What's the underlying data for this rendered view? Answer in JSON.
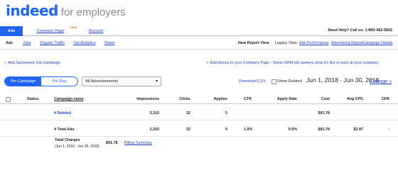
{
  "brand": {
    "logo": "indeed",
    "suffix": "for employers"
  },
  "topnav": {
    "tabs": [
      {
        "label": "Ads",
        "active": true
      },
      {
        "label": "Company Page",
        "active": false
      },
      {
        "label": "Account",
        "active": false
      }
    ],
    "new_badge": "new",
    "help": "Need Help? Call us: 1-800-462-5842"
  },
  "subnav": {
    "items": [
      "Ads",
      "Jobs",
      "Organic Traffic",
      "Job Analytics",
      "Share"
    ],
    "new_report_view": "New Report View",
    "legacy_view_label": "Legacy View:",
    "legacy_links": [
      "Ads Performance",
      "Advertising Report",
      "Campaign Details"
    ]
  },
  "promo": {
    "left": "Add Sponsored Job Campaign",
    "right": "Add photos to your Company Page - Show 200M job seekers what it's like to work at your company."
  },
  "controls": {
    "segments": [
      "Per Campaign",
      "Per Day"
    ],
    "select_value": "All Advertisements",
    "download_csv": "Download CSV",
    "show_deleted": "Show Deleted",
    "date_range": "Jun 1, 2018 - Jun 30, 2018",
    "change": "Change »"
  },
  "table": {
    "headers": [
      "Status",
      "Campaign name",
      "Impressions",
      "Clicks",
      "Applies",
      "CTR",
      "Apply Rate",
      "Cost",
      "Avg CPC",
      "CPA"
    ],
    "rows": [
      {
        "name": "4 Deleted",
        "impressions": "3,310",
        "clicks": "32",
        "applies": "0",
        "ctr": "",
        "apply_rate": "",
        "cost": "$91.78",
        "avg_cpc": "",
        "cpa": ""
      },
      {
        "name": "4 Total Ads",
        "impressions": "3,310",
        "clicks": "32",
        "applies": "0",
        "ctr": "1.0%",
        "apply_rate": "0.0%",
        "cost": "$91.78",
        "avg_cpc": "$2.87",
        "cpa": "-"
      }
    ]
  },
  "charges": {
    "label": "Total Charges",
    "range": "(Jun 1, 2018 - Jun 30, 2018)",
    "amount": "$91.78",
    "billing_link": "Billing Summary"
  },
  "colors": {
    "brand_blue": "#2164f3",
    "link_blue": "#1a3fbf",
    "accent_orange": "#f07a1c"
  }
}
